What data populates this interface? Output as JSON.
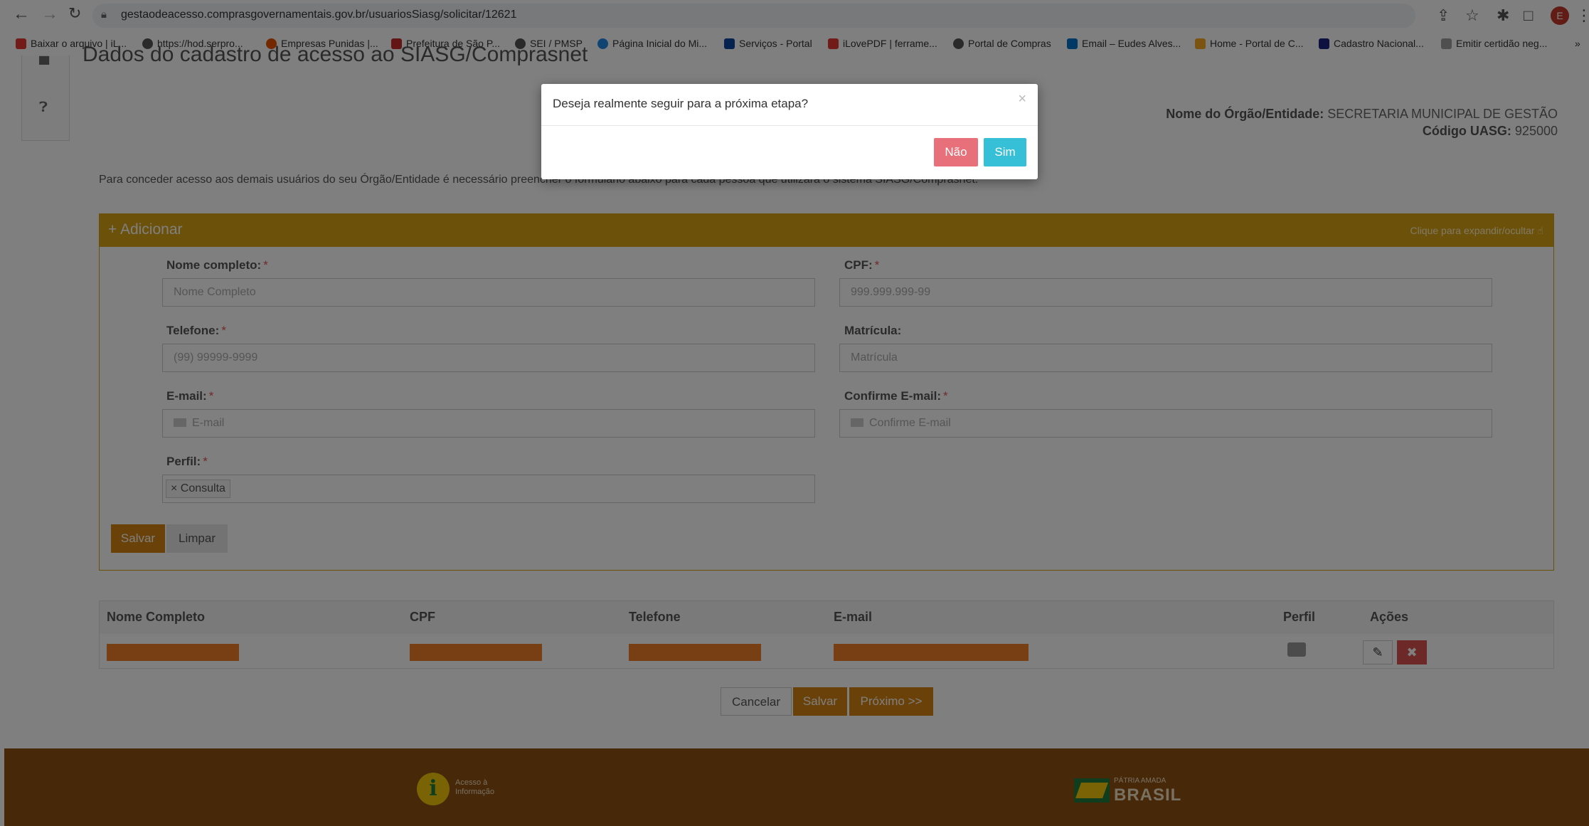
{
  "browser": {
    "url": "gestaodeacesso.comprasgovernamentais.gov.br/usuariosSiasg/solicitar/12621",
    "profile_initial": "E",
    "bookmarks": [
      {
        "label": "Baixar o arquivo | iL...",
        "color": "#e53935"
      },
      {
        "label": "https://hod.serpro...",
        "color": "#555555"
      },
      {
        "label": "Empresas Punidas |...",
        "color": "#e65100"
      },
      {
        "label": "Prefeitura de São P...",
        "color": "#c62828"
      },
      {
        "label": "SEI / PMSP",
        "color": "#555555"
      },
      {
        "label": "Página Inicial do Mi...",
        "color": "#1e88e5"
      },
      {
        "label": "Serviços - Portal",
        "color": "#0d47a1"
      },
      {
        "label": "iLovePDF | ferrame...",
        "color": "#e53935"
      },
      {
        "label": "Portal de Compras",
        "color": "#555555"
      },
      {
        "label": "Email – Eudes Alves...",
        "color": "#0072c6"
      },
      {
        "label": "Home - Portal de C...",
        "color": "#f9a825"
      },
      {
        "label": "Cadastro Nacional...",
        "color": "#1a237e"
      },
      {
        "label": "Emitir certidão neg...",
        "color": "#9e9e9e"
      }
    ],
    "more": "»"
  },
  "page": {
    "title": "Dados do cadastro de acesso ao SIASG/Comprasnet",
    "org_label": "Nome do Órgão/Entidade:",
    "org_value": "SECRETARIA MUNICIPAL DE GESTÃO",
    "uasg_label": "Código UASG:",
    "uasg_value": "925000",
    "intro": "Para conceder acesso aos demais usuários do seu Órgão/Entidade é necessário preencher o formulário abaixo para cada pessoa que utilizará o sistema SIASG/Comprasnet."
  },
  "panel": {
    "title": "+ Adicionar",
    "hint": "Clique para expandir/ocultar ☝",
    "fields": {
      "nome": {
        "label": "Nome completo:",
        "placeholder": "Nome Completo"
      },
      "cpf": {
        "label": "CPF:",
        "placeholder": "999.999.999-99"
      },
      "telefone": {
        "label": "Telefone:",
        "placeholder": "(99) 99999-9999"
      },
      "matricula": {
        "label": "Matrícula:",
        "placeholder": "Matrícula"
      },
      "email": {
        "label": "E-mail:",
        "placeholder": "E-mail"
      },
      "confirme": {
        "label": "Confirme E-mail:",
        "placeholder": "Confirme E-mail"
      },
      "perfil": {
        "label": "Perfil:",
        "tag": "× Consulta"
      }
    },
    "required_mark": "*",
    "save": "Salvar",
    "clear": "Limpar"
  },
  "table": {
    "headers": [
      "Nome Completo",
      "CPF",
      "Telefone",
      "E-mail",
      "Perfil",
      "Ações"
    ]
  },
  "actions": {
    "cancel": "Cancelar",
    "save": "Salvar",
    "next": "Próximo >>"
  },
  "modal": {
    "message": "Deseja realmente seguir para a próxima etapa?",
    "close": "×",
    "no": "Não",
    "yes": "Sim"
  },
  "footer": {
    "acesso_line1": "Acesso à",
    "acesso_line2": "Informação",
    "brasil_small": "PÁTRIA AMADA",
    "brasil_big": "BRASIL"
  }
}
